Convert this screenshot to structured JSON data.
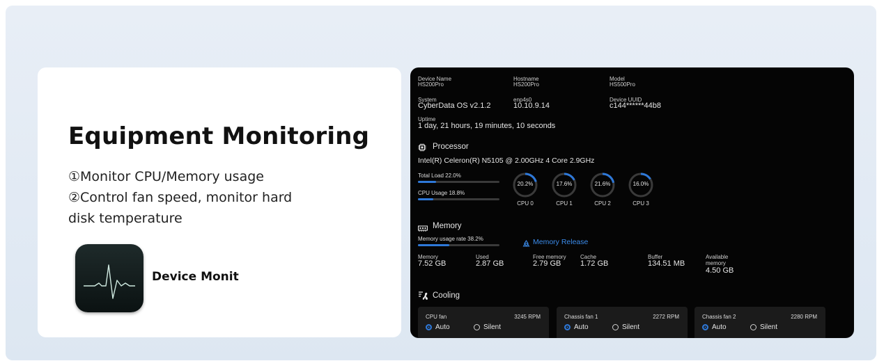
{
  "hero": {
    "title": "Equipment Monitoring",
    "feature1": "①Monitor CPU/Memory usage",
    "feature2_line1": "②Control fan speed, monitor hard",
    "feature2_line2": "disk temperature",
    "app_name": "Device Monit",
    "app_icon": "heartbeat-monitor-icon"
  },
  "device": {
    "device_name_label": "Device Name",
    "device_name": "HS200Pro",
    "hostname_label": "Hostname",
    "hostname": "HS200Pro",
    "model_label": "Model",
    "model": "HS500Pro",
    "system_label": "System",
    "system": "CyberData OS v2.1.2",
    "iface_label": "enp4s0",
    "ip": "10.10.9.14",
    "uuid_label": "Device UUID",
    "uuid": "c144******44b8",
    "uptime_label": "Uptime",
    "uptime": "1 day, 21 hours, 19 minutes, 10 seconds"
  },
  "processor": {
    "title": "Processor",
    "icon": "chip-icon",
    "model": "Intel(R) Celeron(R) N5105 @ 2.00GHz 4 Core 2.9GHz",
    "total_load_label": "Total Load 22.0%",
    "total_load": 0.22,
    "cpu_usage_label": "CPU Usage 18.8%",
    "cpu_usage": 0.188,
    "cores": [
      {
        "name": "CPU 0",
        "text": "20.2%",
        "value": 0.202
      },
      {
        "name": "CPU 1",
        "text": "17.6%",
        "value": 0.176
      },
      {
        "name": "CPU 2",
        "text": "21.6%",
        "value": 0.216
      },
      {
        "name": "CPU 3",
        "text": "16.0%",
        "value": 0.16
      }
    ]
  },
  "memory": {
    "title": "Memory",
    "icon": "memory-icon",
    "usage_label": "Memory usage rate 38.2%",
    "usage": 0.382,
    "release_label": "Memory Release",
    "release_icon": "recycle-icon",
    "stats": [
      {
        "label": "Memory",
        "value": "7.52 GB"
      },
      {
        "label": "Used",
        "value": "2.87 GB"
      },
      {
        "label": "Free memory",
        "value": "2.79 GB"
      },
      {
        "label": "Cache",
        "value": "1.72 GB"
      },
      {
        "label": "Buffer",
        "value": "134.51 MB"
      },
      {
        "label": "Available memory",
        "value": "4.50 GB"
      }
    ]
  },
  "cooling": {
    "title": "Cooling",
    "icon": "fan-icon",
    "auto_label": "Auto",
    "silent_label": "Silent",
    "fans": [
      {
        "name": "CPU fan",
        "rpm": "3245 RPM",
        "mode": "Auto"
      },
      {
        "name": "Chassis fan 1",
        "rpm": "2272 RPM",
        "mode": "Auto"
      },
      {
        "name": "Chassis fan 2",
        "rpm": "2280 RPM",
        "mode": "Auto"
      }
    ]
  },
  "colors": {
    "accent": "#2e78d8",
    "link": "#3b8bea",
    "panel_bg": "#050505"
  }
}
